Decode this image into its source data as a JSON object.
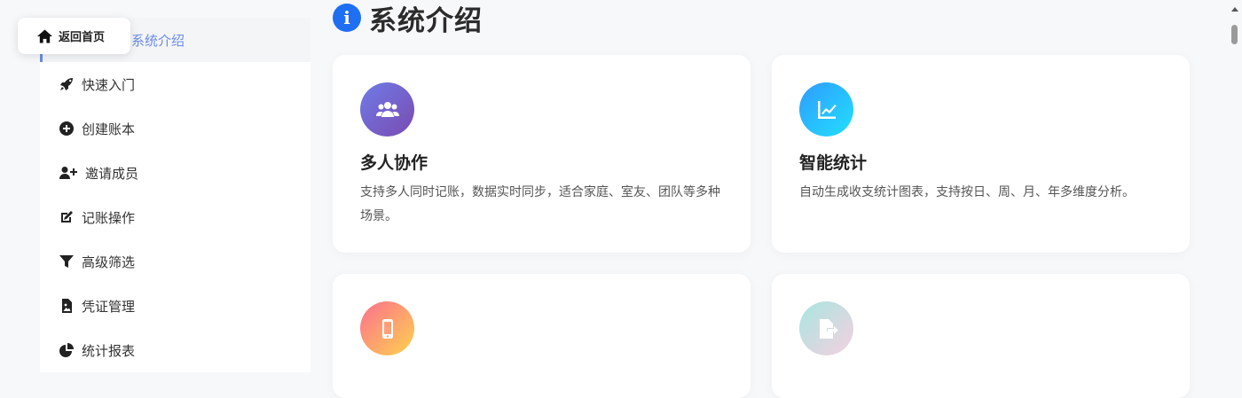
{
  "back_home": {
    "label": "返回首页",
    "icon": "home-icon"
  },
  "page": {
    "title": "系统介绍",
    "title_icon": "info-icon"
  },
  "sidebar": {
    "active_index": 0,
    "items": [
      {
        "label": "系统介绍",
        "icon": "none"
      },
      {
        "label": "快速入门",
        "icon": "rocket-icon"
      },
      {
        "label": "创建账本",
        "icon": "plus-circle-icon"
      },
      {
        "label": "邀请成员",
        "icon": "user-plus-icon"
      },
      {
        "label": "记账操作",
        "icon": "edit-icon"
      },
      {
        "label": "高级筛选",
        "icon": "filter-icon"
      },
      {
        "label": "凭证管理",
        "icon": "file-image-icon"
      },
      {
        "label": "统计报表",
        "icon": "pie-chart-icon"
      }
    ]
  },
  "cards": [
    {
      "title": "多人协作",
      "desc": "支持多人同时记账，数据实时同步，适合家庭、室友、团队等多种场景。",
      "icon": "users-icon",
      "gradient": [
        "#6f7be8",
        "#7a4bb0"
      ]
    },
    {
      "title": "智能统计",
      "desc": "自动生成收支统计图表，支持按日、周、月、年多维度分析。",
      "icon": "chart-line-icon",
      "gradient": [
        "#2f9bff",
        "#22e0ff"
      ]
    },
    {
      "title": "",
      "desc": "",
      "icon": "mobile-icon",
      "gradient": [
        "#fb6f8f",
        "#ffd24d"
      ]
    },
    {
      "title": "",
      "desc": "",
      "icon": "file-export-icon",
      "gradient": [
        "#a8e6e0",
        "#f5d0e0"
      ]
    }
  ],
  "colors": {
    "accent": "#6a8be8",
    "title_icon_bg": "#1f6ff2"
  }
}
